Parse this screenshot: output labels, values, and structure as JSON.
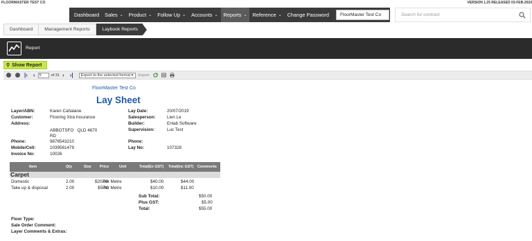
{
  "header": {
    "company": "FLOORMASTER TEST CO",
    "version": "VERSION 1.25 RELEASED 03-FEB-2020"
  },
  "nav": {
    "items": [
      {
        "label": "Dashboard",
        "dropdown": false,
        "active": false
      },
      {
        "label": "Sales",
        "dropdown": true,
        "active": false
      },
      {
        "label": "Product",
        "dropdown": true,
        "active": false
      },
      {
        "label": "Follow Up",
        "dropdown": true,
        "active": false
      },
      {
        "label": "Accounts",
        "dropdown": true,
        "active": false
      },
      {
        "label": "Reports",
        "dropdown": true,
        "active": true
      },
      {
        "label": "Reference",
        "dropdown": true,
        "active": false
      },
      {
        "label": "Change Password",
        "dropdown": false,
        "active": false
      }
    ],
    "company_selector": "FloorMaster Test Co"
  },
  "search": {
    "placeholder": "Search for contract"
  },
  "breadcrumb": [
    "Dashboard",
    "Management Reports",
    "Laybook Reports"
  ],
  "report_header": {
    "title": "Report"
  },
  "show_report_label": "Show Report",
  "toolbar": {
    "page_value": "5",
    "page_of": "of 31",
    "export_select": "Export to the selected format",
    "export_link": "Export"
  },
  "report": {
    "company": "FloorMaster Test Co",
    "title": "Lay Sheet",
    "left_fields": {
      "layer_label": "Layer/ABN:",
      "layer_value": "Karen Cahalane",
      "customer_label": "Customer:",
      "customer_value": "Flooring Xtra Insurance",
      "address_label": "Address:",
      "address_line1": "ABBOTSFO   QLD 4670",
      "address_line2": "RD",
      "phone_label": "Phone:",
      "phone_value": "9876543210",
      "mobile_label": "Mobile/Cell:",
      "mobile_value": "1039561479",
      "invoice_label": "Invoice No:",
      "invoice_value": "10026"
    },
    "right_fields": {
      "lay_date_label": "Lay Date:",
      "lay_date_value": "20/07/2019",
      "salesperson_label": "Salesperson:",
      "salesperson_value": "Lien Le",
      "builder_label": "Builder:",
      "builder_value": "Enlab Software",
      "supervision_label": "Supervision:",
      "supervision_value": "Luc Test",
      "phone_label": "Phone:",
      "lay_no_label": "Lay No:",
      "lay_no_value": "107328"
    },
    "table": {
      "headers": [
        "Item",
        "Qty",
        "Size",
        "Price",
        "Unit",
        "Total(Ex GST)",
        "Total(Inc GST)",
        "Comments"
      ],
      "group": "Carpet",
      "rows": [
        {
          "item": "Domestic",
          "qty": "2.00",
          "price": "$20.00",
          "unit": "Per Metre",
          "total_ex": "$40.00",
          "total_inc": "$44.00"
        },
        {
          "item": "Take up & disposal",
          "qty": "2.00",
          "price": "$5.00",
          "unit": "Per Metre",
          "total_ex": "$10.00",
          "total_inc": "$11.00"
        }
      ],
      "subtotal_label": "Sub Total:",
      "subtotal_value": "$50.00",
      "gst_label": "Plus GST:",
      "gst_value": "$5.00",
      "total_label": "Total:",
      "total_value": "$55.00"
    },
    "footer": {
      "floor_type": "Floor Type:",
      "sale_order_comment": "Sale Order Comment:",
      "layer_comments": "Layer Comments & Extras:"
    }
  }
}
